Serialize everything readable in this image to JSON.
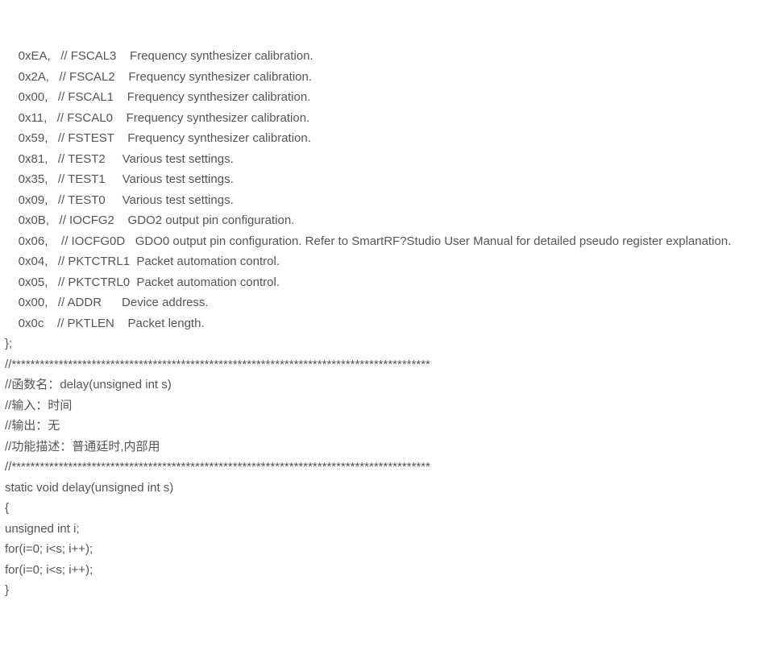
{
  "lines": [
    "    0xEA,   // FSCAL3    Frequency synthesizer calibration.",
    "    0x2A,   // FSCAL2    Frequency synthesizer calibration.",
    "    0x00,   // FSCAL1    Frequency synthesizer calibration.",
    "    0x11,   // FSCAL0    Frequency synthesizer calibration.",
    "    0x59,   // FSTEST    Frequency synthesizer calibration.",
    "    0x81,   // TEST2     Various test settings.",
    "    0x35,   // TEST1     Various test settings.",
    "    0x09,   // TEST0     Various test settings.",
    "    0x0B,   // IOCFG2    GDO2 output pin configuration.",
    "    0x06,    // IOCFG0D   GDO0 output pin configuration. Refer to SmartRF?Studio User Manual for detailed pseudo register explanation.",
    "    0x04,   // PKTCTRL1  Packet automation control.",
    "    0x05,   // PKTCTRL0  Packet automation control.",
    "    0x00,   // ADDR      Device address.",
    "    0x0c    // PKTLEN    Packet length.",
    "};",
    "//*****************************************************************************************",
    "//函数名：delay(unsigned int s)",
    "//输入：时间",
    "//输出：无",
    "//功能描述：普通廷时,内部用",
    "//*****************************************************************************************",
    "static void delay(unsigned int s)",
    "{",
    "unsigned int i;",
    "for(i=0; i<s; i++);",
    "for(i=0; i<s; i++);",
    "}"
  ]
}
